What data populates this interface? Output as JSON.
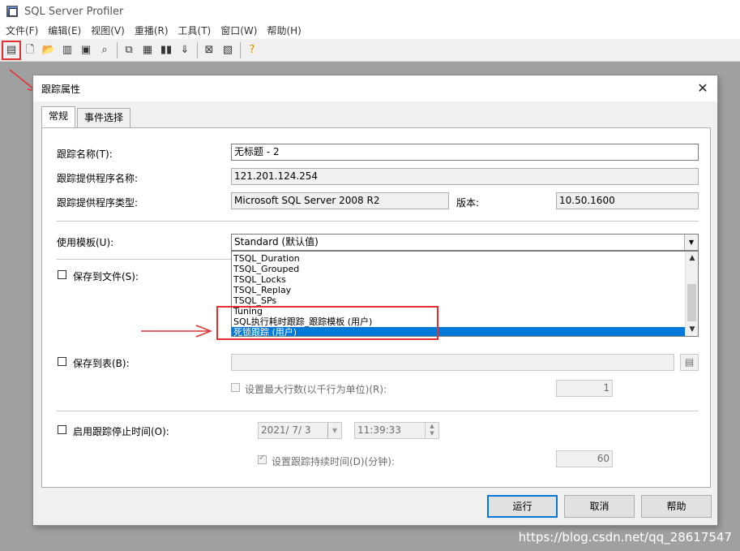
{
  "app": {
    "title": "SQL Server Profiler"
  },
  "menu": [
    {
      "label": "文件(F)"
    },
    {
      "label": "编辑(E)"
    },
    {
      "label": "视图(V)"
    },
    {
      "label": "重播(R)"
    },
    {
      "label": "工具(T)"
    },
    {
      "label": "窗口(W)"
    },
    {
      "label": "帮助(H)"
    }
  ],
  "toolbar": {
    "icons": [
      "new-trace-icon",
      "new-file-icon",
      "open-icon",
      "save-icon",
      "properties-icon",
      "find-icon",
      "copy-icon",
      "pause-icon",
      "step-icon",
      "stop-icon",
      "run-icon",
      "chart-icon",
      "help-icon"
    ]
  },
  "dialog": {
    "title": "跟踪属性",
    "close": "✕",
    "tabs": [
      {
        "label": "常规"
      },
      {
        "label": "事件选择"
      }
    ],
    "trace_name": {
      "label": "跟踪名称(T):",
      "value": "无标题 - 2"
    },
    "provider_name": {
      "label": "跟踪提供程序名称:",
      "value": "121.201.124.254"
    },
    "provider_type": {
      "label": "跟踪提供程序类型:",
      "value": "Microsoft SQL Server 2008 R2"
    },
    "version": {
      "label": "版本:",
      "value": "10.50.1600"
    },
    "template": {
      "label": "使用模板(U):",
      "value": "Standard (默认值)",
      "options": [
        "TSQL_Duration",
        "TSQL_Grouped",
        "TSQL_Locks",
        "TSQL_Replay",
        "TSQL_SPs",
        "Tuning",
        "SQL执行耗时跟踪_跟踪模板 (用户)",
        "死锁跟踪 (用户)"
      ],
      "selected_index": 7
    },
    "save_to_file": {
      "label": "保存到文件(S):"
    },
    "save_to_table": {
      "label": "保存到表(B):"
    },
    "max_rows": {
      "label": "设置最大行数(以千行为单位)(R):",
      "value": "1"
    },
    "stop_time": {
      "label": "启用跟踪停止时间(O):",
      "date": "2021/ 7/ 3",
      "time": "11:39:33"
    },
    "duration": {
      "label": "设置跟踪持续时间(D)(分钟):",
      "value": "60"
    },
    "buttons": {
      "run": "运行",
      "cancel": "取消",
      "help": "帮助"
    }
  },
  "watermark": "https://blog.csdn.net/qq_28617547",
  "colors": {
    "annotation": "#e03030",
    "selection": "#0078d7"
  }
}
